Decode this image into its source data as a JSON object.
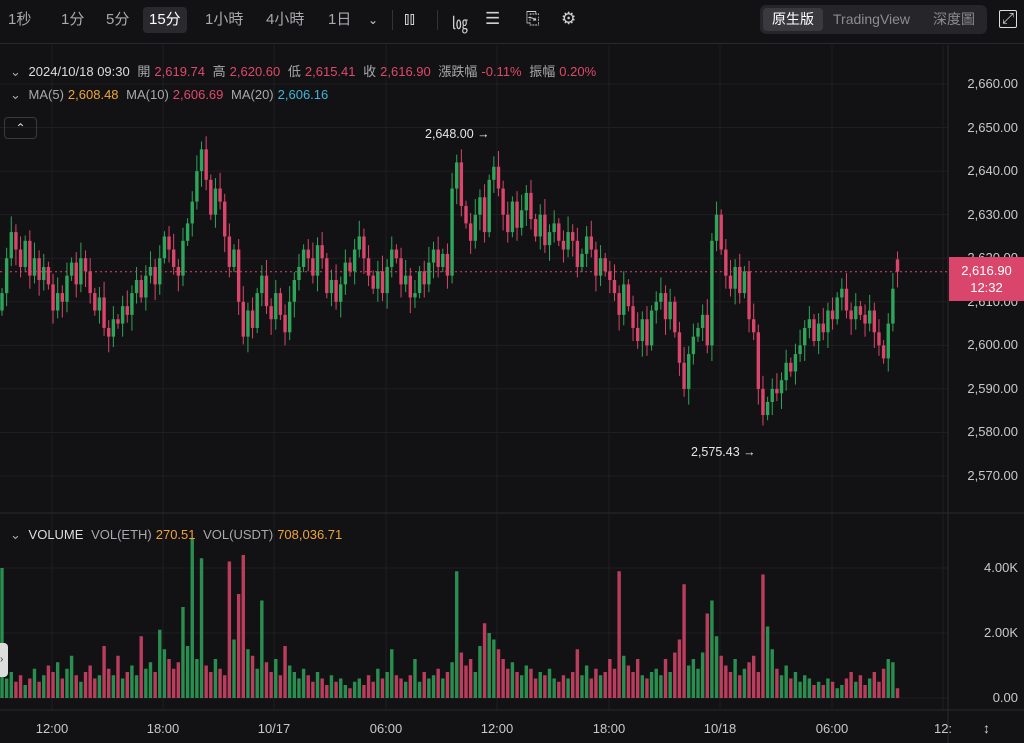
{
  "toolbar": {
    "timeframes": [
      "1秒",
      "1分",
      "5分",
      "15分",
      "1小時",
      "4小時",
      "1日"
    ],
    "active_timeframe": "15分",
    "views": [
      "原生版",
      "TradingView",
      "深度圖"
    ],
    "active_view": "原生版"
  },
  "ohlc_row": {
    "datetime": "2024/10/18 09:30",
    "open_label": "開",
    "open": "2,619.74",
    "high_label": "高",
    "high": "2,620.60",
    "low_label": "低",
    "low": "2,615.41",
    "close_label": "收",
    "close": "2,616.90",
    "change_label": "漲跌幅",
    "change": "-0.11%",
    "amp_label": "振幅",
    "amp": "0.20%"
  },
  "ma_row": {
    "ma5_label": "MA(5)",
    "ma5": "2,608.48",
    "ma10_label": "MA(10)",
    "ma10": "2,606.69",
    "ma20_label": "MA(20)",
    "ma20": "2,606.16"
  },
  "volume_row": {
    "label": "VOLUME",
    "eth_label": "VOL(ETH)",
    "eth": "270.51",
    "usdt_label": "VOL(USDT)",
    "usdt": "708,036.71"
  },
  "current_price": {
    "price": "2,616.90",
    "countdown": "12:32"
  },
  "annotations": {
    "high": "2,648.00",
    "low": "2,575.43"
  },
  "colors": {
    "up": "#2ea55a",
    "down": "#d9456b",
    "bg": "#121214"
  },
  "chart_data": {
    "type": "candlestick",
    "price_axis": {
      "ticks": [
        "2,660.00",
        "2,650.00",
        "2,640.00",
        "2,630.00",
        "2,620.00",
        "2,610.00",
        "2,600.00",
        "2,590.00",
        "2,580.00",
        "2,570.00"
      ],
      "range": [
        2560,
        2662
      ]
    },
    "volume_axis": {
      "ticks": [
        "4.00K",
        "2.00K",
        "0.00"
      ],
      "unit": "K"
    },
    "time_axis": {
      "ticks": [
        "12:00",
        "18:00",
        "10/17",
        "06:00",
        "12:00",
        "18:00",
        "10/18",
        "06:00",
        "12:"
      ]
    },
    "first_open": 2608,
    "last_open": 2619.74,
    "close": [
      2612,
      2620,
      2626,
      2622,
      2618,
      2624,
      2616,
      2620,
      2615,
      2618,
      2614,
      2608,
      2612,
      2610,
      2616,
      2619,
      2614,
      2620,
      2617,
      2612,
      2608,
      2611,
      2604,
      2602,
      2606,
      2605,
      2609,
      2607,
      2612,
      2615,
      2611,
      2616,
      2618,
      2614,
      2620,
      2625,
      2622,
      2618,
      2616,
      2624,
      2628,
      2633,
      2640,
      2645,
      2638,
      2630,
      2636,
      2633,
      2625,
      2618,
      2622,
      2610,
      2602,
      2608,
      2604,
      2612,
      2616,
      2609,
      2606,
      2612,
      2607,
      2603,
      2610,
      2615,
      2618,
      2622,
      2620,
      2616,
      2623,
      2620,
      2612,
      2615,
      2610,
      2614,
      2619,
      2617,
      2622,
      2625,
      2620,
      2616,
      2613,
      2617,
      2612,
      2618,
      2622,
      2620,
      2614,
      2616,
      2611,
      2612,
      2617,
      2614,
      2619,
      2622,
      2618,
      2621,
      2616,
      2636,
      2642,
      2632,
      2628,
      2624,
      2630,
      2634,
      2626,
      2638,
      2641,
      2636,
      2630,
      2626,
      2633,
      2627,
      2631,
      2635,
      2629,
      2625,
      2630,
      2623,
      2626,
      2628,
      2624,
      2622,
      2626,
      2624,
      2618,
      2621,
      2625,
      2622,
      2616,
      2620,
      2617,
      2615,
      2612,
      2607,
      2614,
      2609,
      2604,
      2601,
      2606,
      2600,
      2608,
      2610,
      2612,
      2606,
      2610,
      2603,
      2596,
      2590,
      2598,
      2602,
      2604,
      2607,
      2600,
      2624,
      2630,
      2622,
      2616,
      2613,
      2618,
      2612,
      2617,
      2606,
      2603,
      2590,
      2584,
      2587,
      2590,
      2589,
      2592,
      2596,
      2594,
      2598,
      2600,
      2604,
      2606,
      2601,
      2605,
      2603,
      2608,
      2606,
      2611,
      2613,
      2608,
      2606,
      2609,
      2607,
      2605,
      2608,
      2603,
      2600,
      2597,
      2605,
      2613,
      2616.9
    ],
    "volume_k": [
      4.0,
      0.6,
      0.8,
      0.5,
      0.7,
      0.4,
      0.6,
      0.9,
      0.5,
      0.7,
      1.0,
      0.8,
      1.1,
      0.6,
      0.9,
      1.3,
      0.7,
      0.5,
      0.8,
      1.0,
      0.6,
      0.7,
      1.6,
      0.9,
      0.7,
      1.3,
      0.6,
      0.8,
      1.0,
      0.7,
      1.9,
      0.9,
      1.1,
      0.8,
      2.1,
      1.5,
      1.2,
      0.9,
      1.1,
      2.8,
      1.6,
      4.9,
      1.2,
      4.3,
      1.0,
      0.8,
      1.2,
      0.9,
      0.7,
      4.2,
      1.8,
      3.2,
      4.4,
      1.5,
      1.3,
      0.9,
      3.0,
      1.1,
      0.8,
      1.2,
      0.7,
      1.6,
      1.0,
      0.8,
      0.6,
      0.9,
      0.7,
      0.5,
      0.8,
      0.6,
      0.4,
      0.7,
      0.5,
      0.6,
      0.4,
      0.3,
      0.5,
      0.6,
      0.4,
      0.7,
      0.5,
      0.9,
      0.6,
      0.8,
      1.5,
      0.7,
      0.6,
      0.5,
      0.7,
      1.2,
      0.5,
      0.8,
      0.6,
      0.7,
      0.9,
      0.6,
      0.8,
      1.1,
      3.9,
      1.4,
      1.0,
      1.2,
      0.8,
      1.6,
      2.3,
      2.0,
      1.8,
      1.5,
      1.2,
      0.9,
      1.1,
      0.8,
      0.7,
      1.0,
      0.9,
      0.6,
      0.8,
      0.7,
      0.9,
      0.6,
      0.5,
      0.7,
      0.6,
      0.8,
      1.5,
      0.7,
      1.0,
      0.6,
      0.9,
      0.7,
      0.8,
      1.2,
      0.9,
      3.9,
      1.3,
      1.0,
      0.8,
      1.2,
      0.7,
      0.6,
      0.8,
      0.9,
      0.7,
      1.2,
      0.8,
      1.4,
      1.8,
      3.5,
      1.0,
      1.2,
      0.9,
      1.4,
      2.6,
      3.0,
      1.9,
      1.3,
      1.0,
      0.8,
      1.2,
      0.7,
      0.9,
      1.1,
      1.3,
      0.8,
      3.8,
      2.2,
      1.5,
      0.9,
      0.7,
      1.0,
      0.6,
      0.8,
      0.5,
      0.7,
      0.6,
      0.4,
      0.5,
      0.4,
      0.6,
      0.5,
      0.3,
      0.4,
      0.6,
      0.8,
      0.5,
      0.7,
      0.4,
      0.6,
      0.8,
      0.5,
      0.9,
      1.2,
      1.1,
      0.3
    ]
  }
}
